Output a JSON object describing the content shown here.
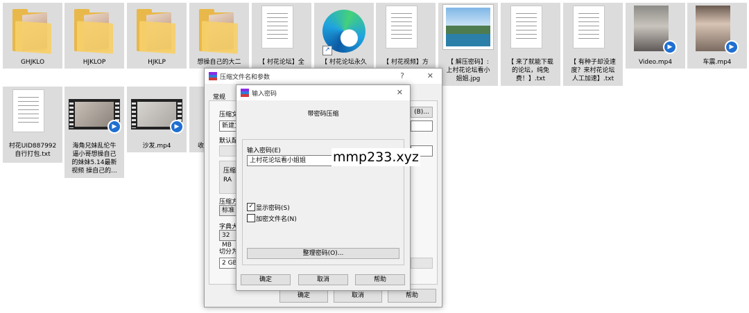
{
  "files": [
    {
      "name": "GHJKLO",
      "type": "folder"
    },
    {
      "name": "HJKLOP",
      "type": "folder"
    },
    {
      "name": "HJKLP",
      "type": "folder"
    },
    {
      "name": "想操自己的大二",
      "type": "folder"
    },
    {
      "name": "【 村花论坛】全",
      "type": "txt"
    },
    {
      "name": "【 村花论坛永久",
      "type": "shortcut"
    },
    {
      "name": "【 村花视频】方",
      "type": "txt"
    },
    {
      "name": "【 解压密码】:\n上村花论坛看小\n姐姐.jpg",
      "type": "jpg"
    },
    {
      "name": "【 来了就能下载\n的论坛，纯免\n费！】.txt",
      "type": "txt"
    },
    {
      "name": "【 有种子却没速\n度？来村花论坛\n人工加速】.txt",
      "type": "txt"
    },
    {
      "name": "Video.mp4",
      "type": "mp4"
    },
    {
      "name": "车震.mp4",
      "type": "mp4"
    },
    {
      "name": "村花UID887992\n自行打包.txt",
      "type": "txt"
    },
    {
      "name": "海角兄妹乱伦牛\n逼小哥想操自己\n的妹妹5.14最新\n视频 操自己的...",
      "type": "mp4"
    },
    {
      "name": "沙发.mp4",
      "type": "mp4"
    },
    {
      "name": "收",
      "type": "folder"
    }
  ],
  "back_dialog": {
    "title": "压缩文件名和参数",
    "help_glyph": "?",
    "close_glyph": "✕",
    "tab_general": "常规",
    "labels": [
      "压缩文",
      "新建文",
      "默认配",
      "压缩",
      "RA",
      "压缩方",
      "标准",
      "字典大",
      "32 MB",
      "切分为",
      "2 GB"
    ],
    "browse_button": "(B)...",
    "ok": "确定",
    "cancel": "取消",
    "help": "帮助"
  },
  "pwd_dialog": {
    "title": "输入密码",
    "close_glyph": "✕",
    "heading": "带密码压缩",
    "password_label": "输入密码(E)",
    "password_value": "上村花论坛看小姐姐",
    "show_password_label": "显示密码(S)",
    "show_password_checked": true,
    "encrypt_names_label": "加密文件名(N)",
    "encrypt_names_checked": false,
    "organize_button": "整理密码(O)...",
    "ok": "确定",
    "cancel": "取消",
    "help": "帮助"
  },
  "overlay": {
    "text": "mmp233.xyz"
  }
}
